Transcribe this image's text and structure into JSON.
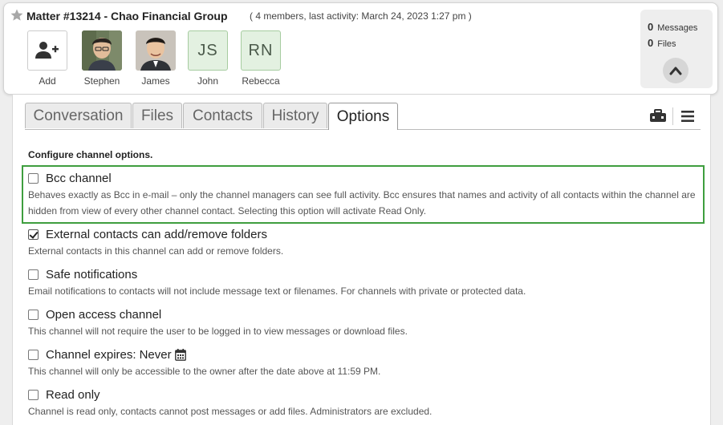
{
  "header": {
    "title": "Matter #13214 - Chao Financial Group",
    "meta": "( 4 members, last activity: March 24, 2023 1:27 pm )",
    "add_label": "Add",
    "members": [
      {
        "name": "Stephen",
        "type": "photo"
      },
      {
        "name": "James",
        "type": "photo"
      },
      {
        "name": "John",
        "type": "initials",
        "initials": "JS"
      },
      {
        "name": "Rebecca",
        "type": "initials",
        "initials": "RN"
      }
    ],
    "stats": {
      "messages_count": "0",
      "messages_label": "Messages",
      "files_count": "0",
      "files_label": "Files"
    }
  },
  "tabs": [
    {
      "label": "Conversation",
      "active": false
    },
    {
      "label": "Files",
      "active": false
    },
    {
      "label": "Contacts",
      "active": false
    },
    {
      "label": "History",
      "active": false
    },
    {
      "label": "Options",
      "active": true
    }
  ],
  "options": {
    "heading": "Configure channel options.",
    "items": [
      {
        "label": "Bcc channel",
        "checked": false,
        "description": "Behaves exactly as Bcc in e-mail – only the channel managers can see full activity. Bcc ensures that names and activity of all contacts within the channel are hidden from view of every other channel contact. Selecting this option will activate Read Only."
      },
      {
        "label": "External contacts can add/remove folders",
        "checked": true,
        "description": "External contacts in this channel can add or remove folders."
      },
      {
        "label": "Safe notifications",
        "checked": false,
        "description": "Email notifications to contacts will not include message text or filenames. For channels with private or protected data."
      },
      {
        "label": "Open access channel",
        "checked": false,
        "description": "This channel will not require the user to be logged in to view messages or download files."
      },
      {
        "label": "Channel expires:",
        "value": "Never",
        "checked": false,
        "description": "This channel will only be accessible to the owner after the date above at 11:59 PM."
      },
      {
        "label": "Read only",
        "checked": false,
        "description": "Channel is read only, contacts cannot post messages or add files. Administrators are excluded."
      }
    ]
  },
  "colors": {
    "highlight": "#3f9e3f",
    "initials_bg": "#e3f1e1",
    "initials_border": "#a6cca0"
  },
  "icons": [
    "star-icon",
    "add-user-icon",
    "chevron-up-icon",
    "toolbox-icon",
    "hamburger-menu-icon",
    "calendar-icon"
  ]
}
